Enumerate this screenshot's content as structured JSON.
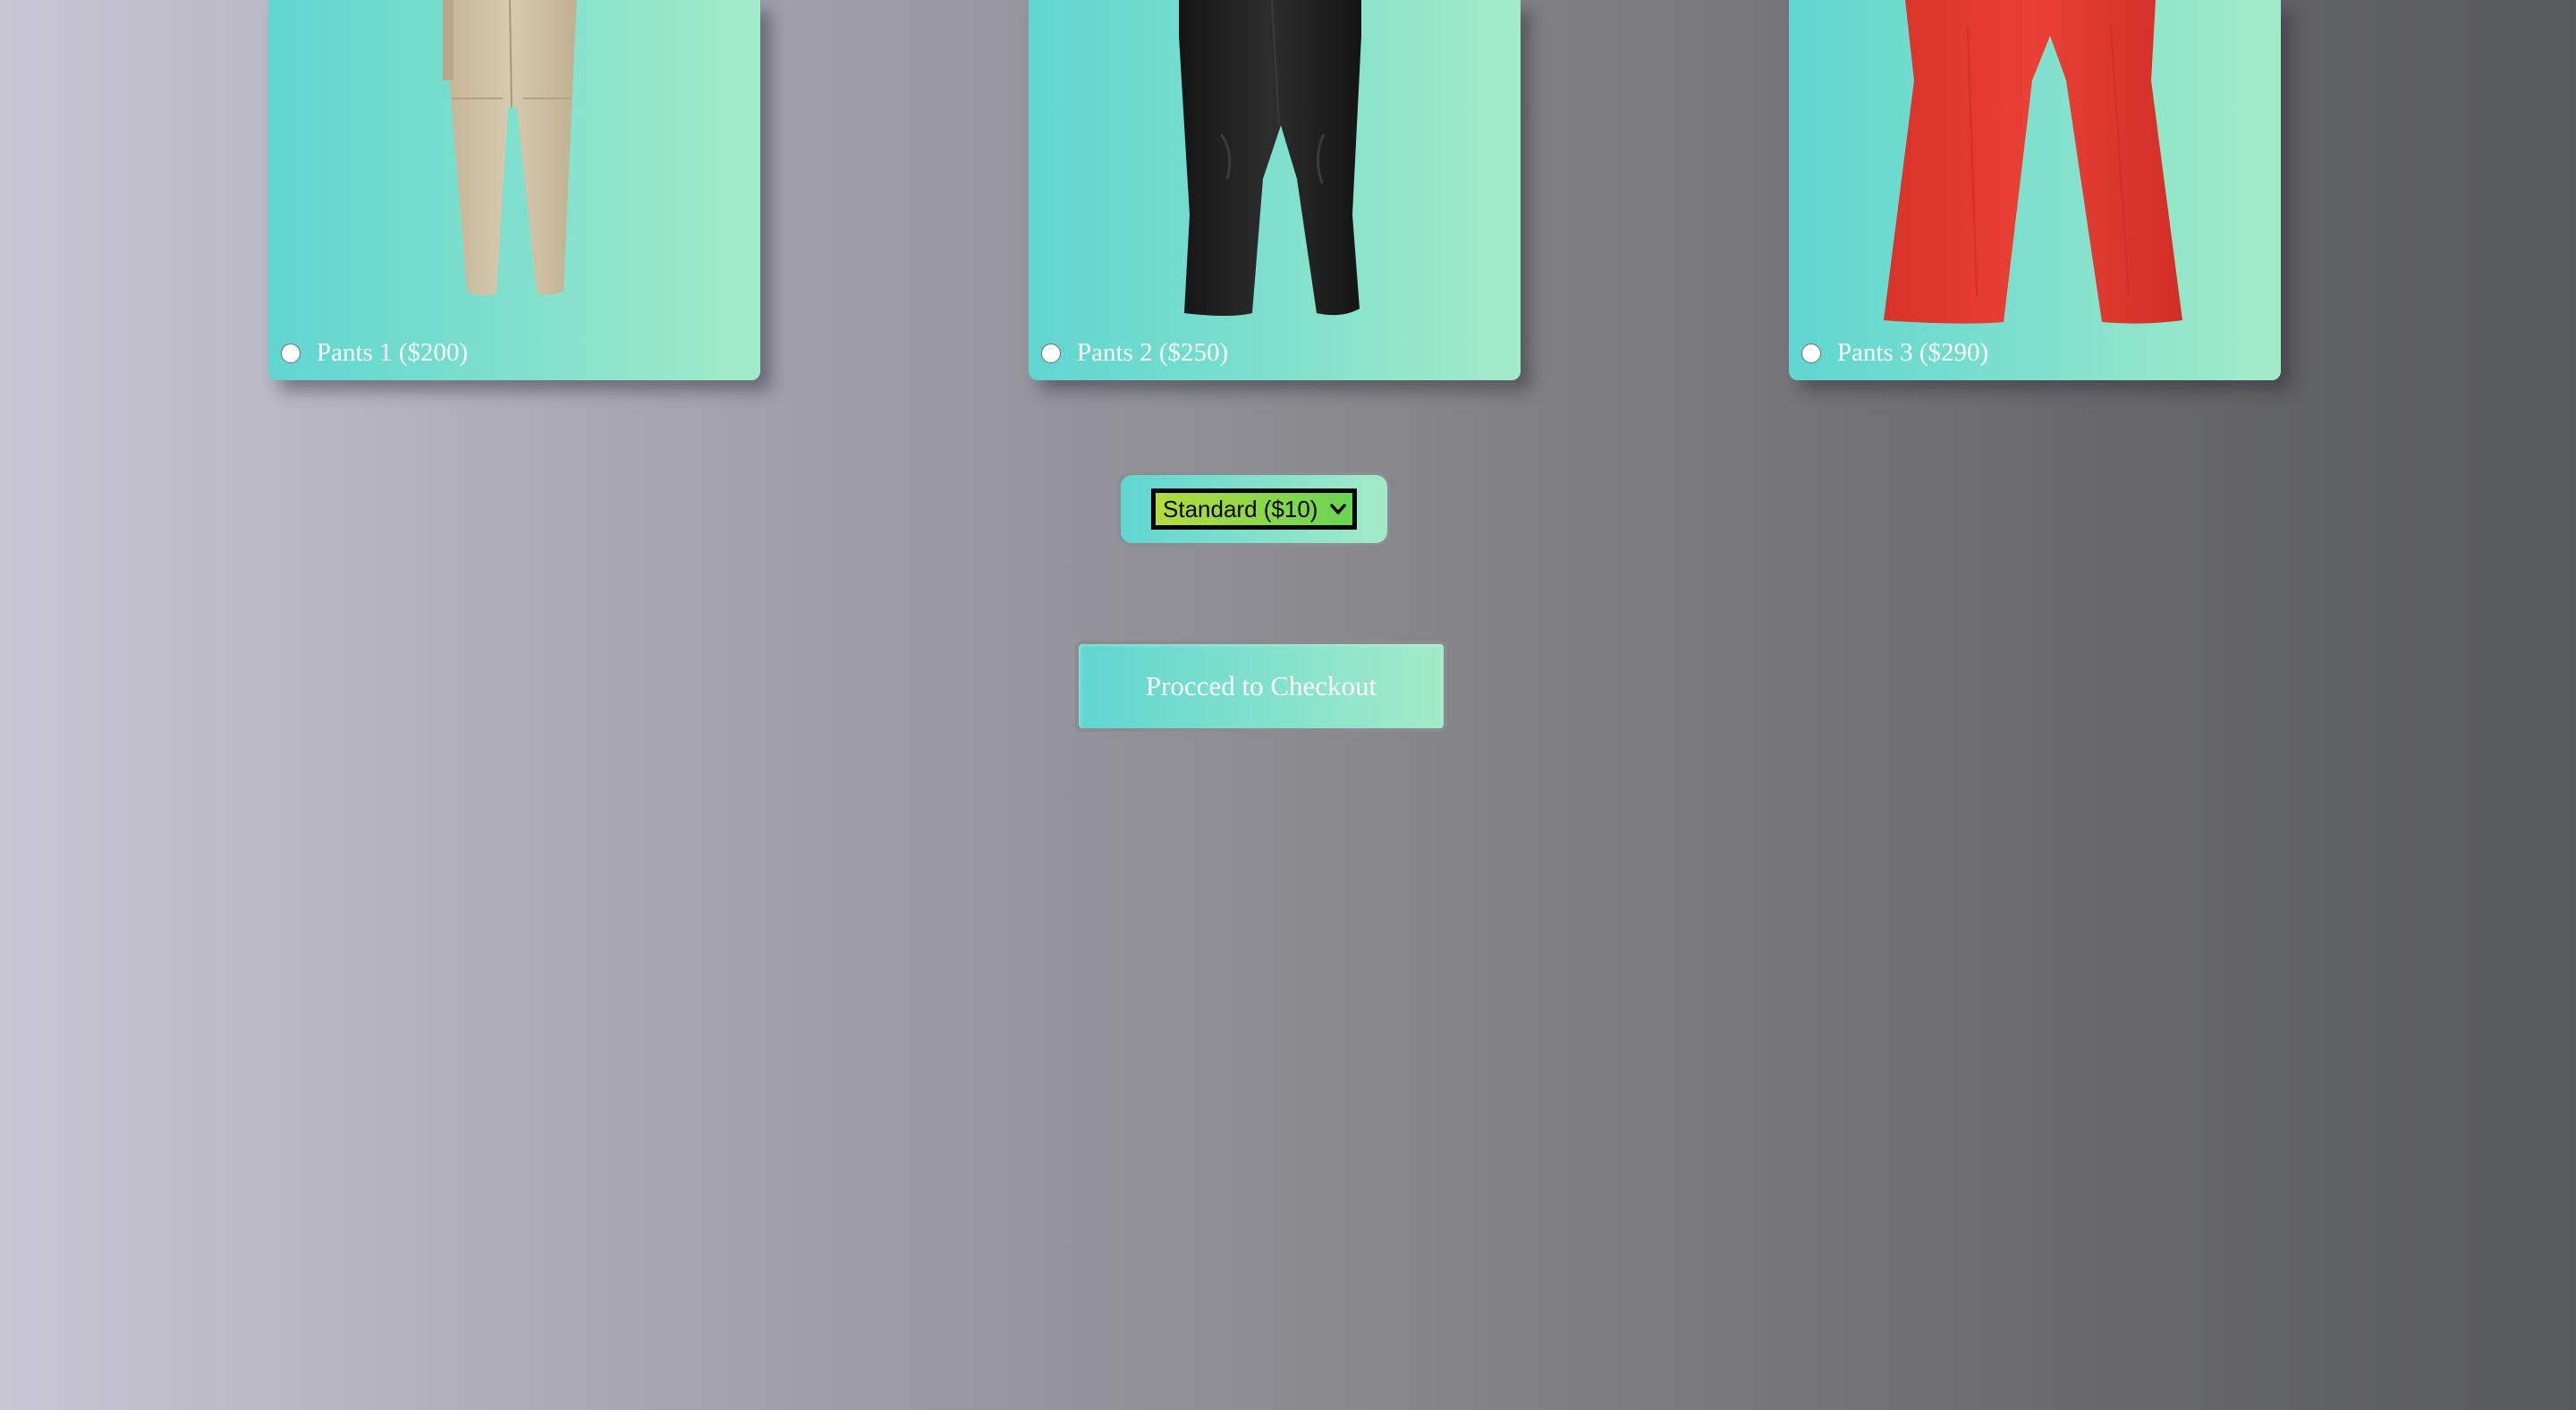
{
  "products": [
    {
      "label": "Pants 1 ($200)",
      "image": "khaki-pants",
      "color": "#cdbfa5",
      "selected": false
    },
    {
      "label": "Pants 2 ($250)",
      "image": "black-pants",
      "color": "#1f1f1f",
      "selected": false
    },
    {
      "label": "Pants 3 ($290)",
      "image": "red-pants",
      "color": "#e13a30",
      "selected": false
    }
  ],
  "shipping": {
    "selected_label": "Standard ($10)",
    "icon": "chevron-down-icon"
  },
  "checkout": {
    "button_label": "Procced to Checkout"
  },
  "colors": {
    "card_gradient_start": "#5fd6d0",
    "card_gradient_end": "#a3ebc8",
    "select_gradient_start": "#b2dc3c",
    "select_gradient_end": "#6ad454"
  }
}
